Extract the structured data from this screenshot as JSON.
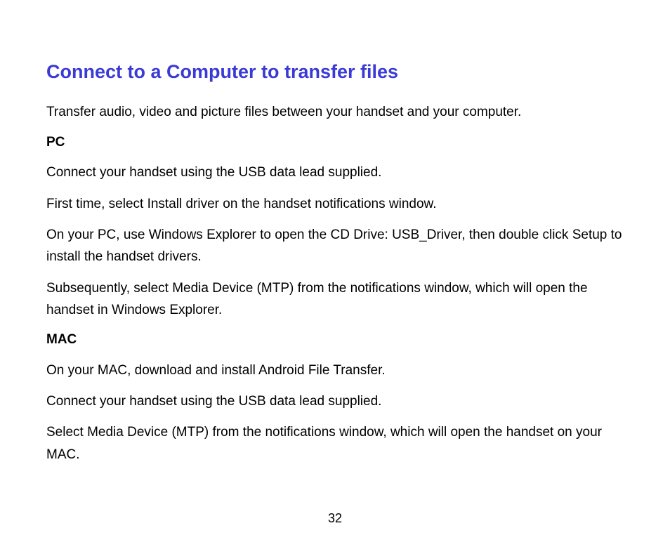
{
  "title": "Connect to a Computer to transfer files",
  "intro": "Transfer audio, video and picture files between your handset and your computer.",
  "pcHeading": "PC",
  "pcParagraphs": [
    "Connect your handset using the USB data lead supplied.",
    "First time, select Install driver on the handset notifications window.",
    "On your PC, use Windows Explorer to open the CD Drive: USB_Driver, then double click Setup to install the handset drivers.",
    "Subsequently, select Media Device (MTP) from the notifications window, which will open the handset in Windows Explorer."
  ],
  "macHeading": "MAC",
  "macParagraphs": [
    "On your MAC, download and install Android File Transfer.",
    "Connect your handset using the USB data lead supplied.",
    "Select Media Device (MTP) from the notifications window, which will open the handset on your MAC."
  ],
  "pageNumber": "32"
}
